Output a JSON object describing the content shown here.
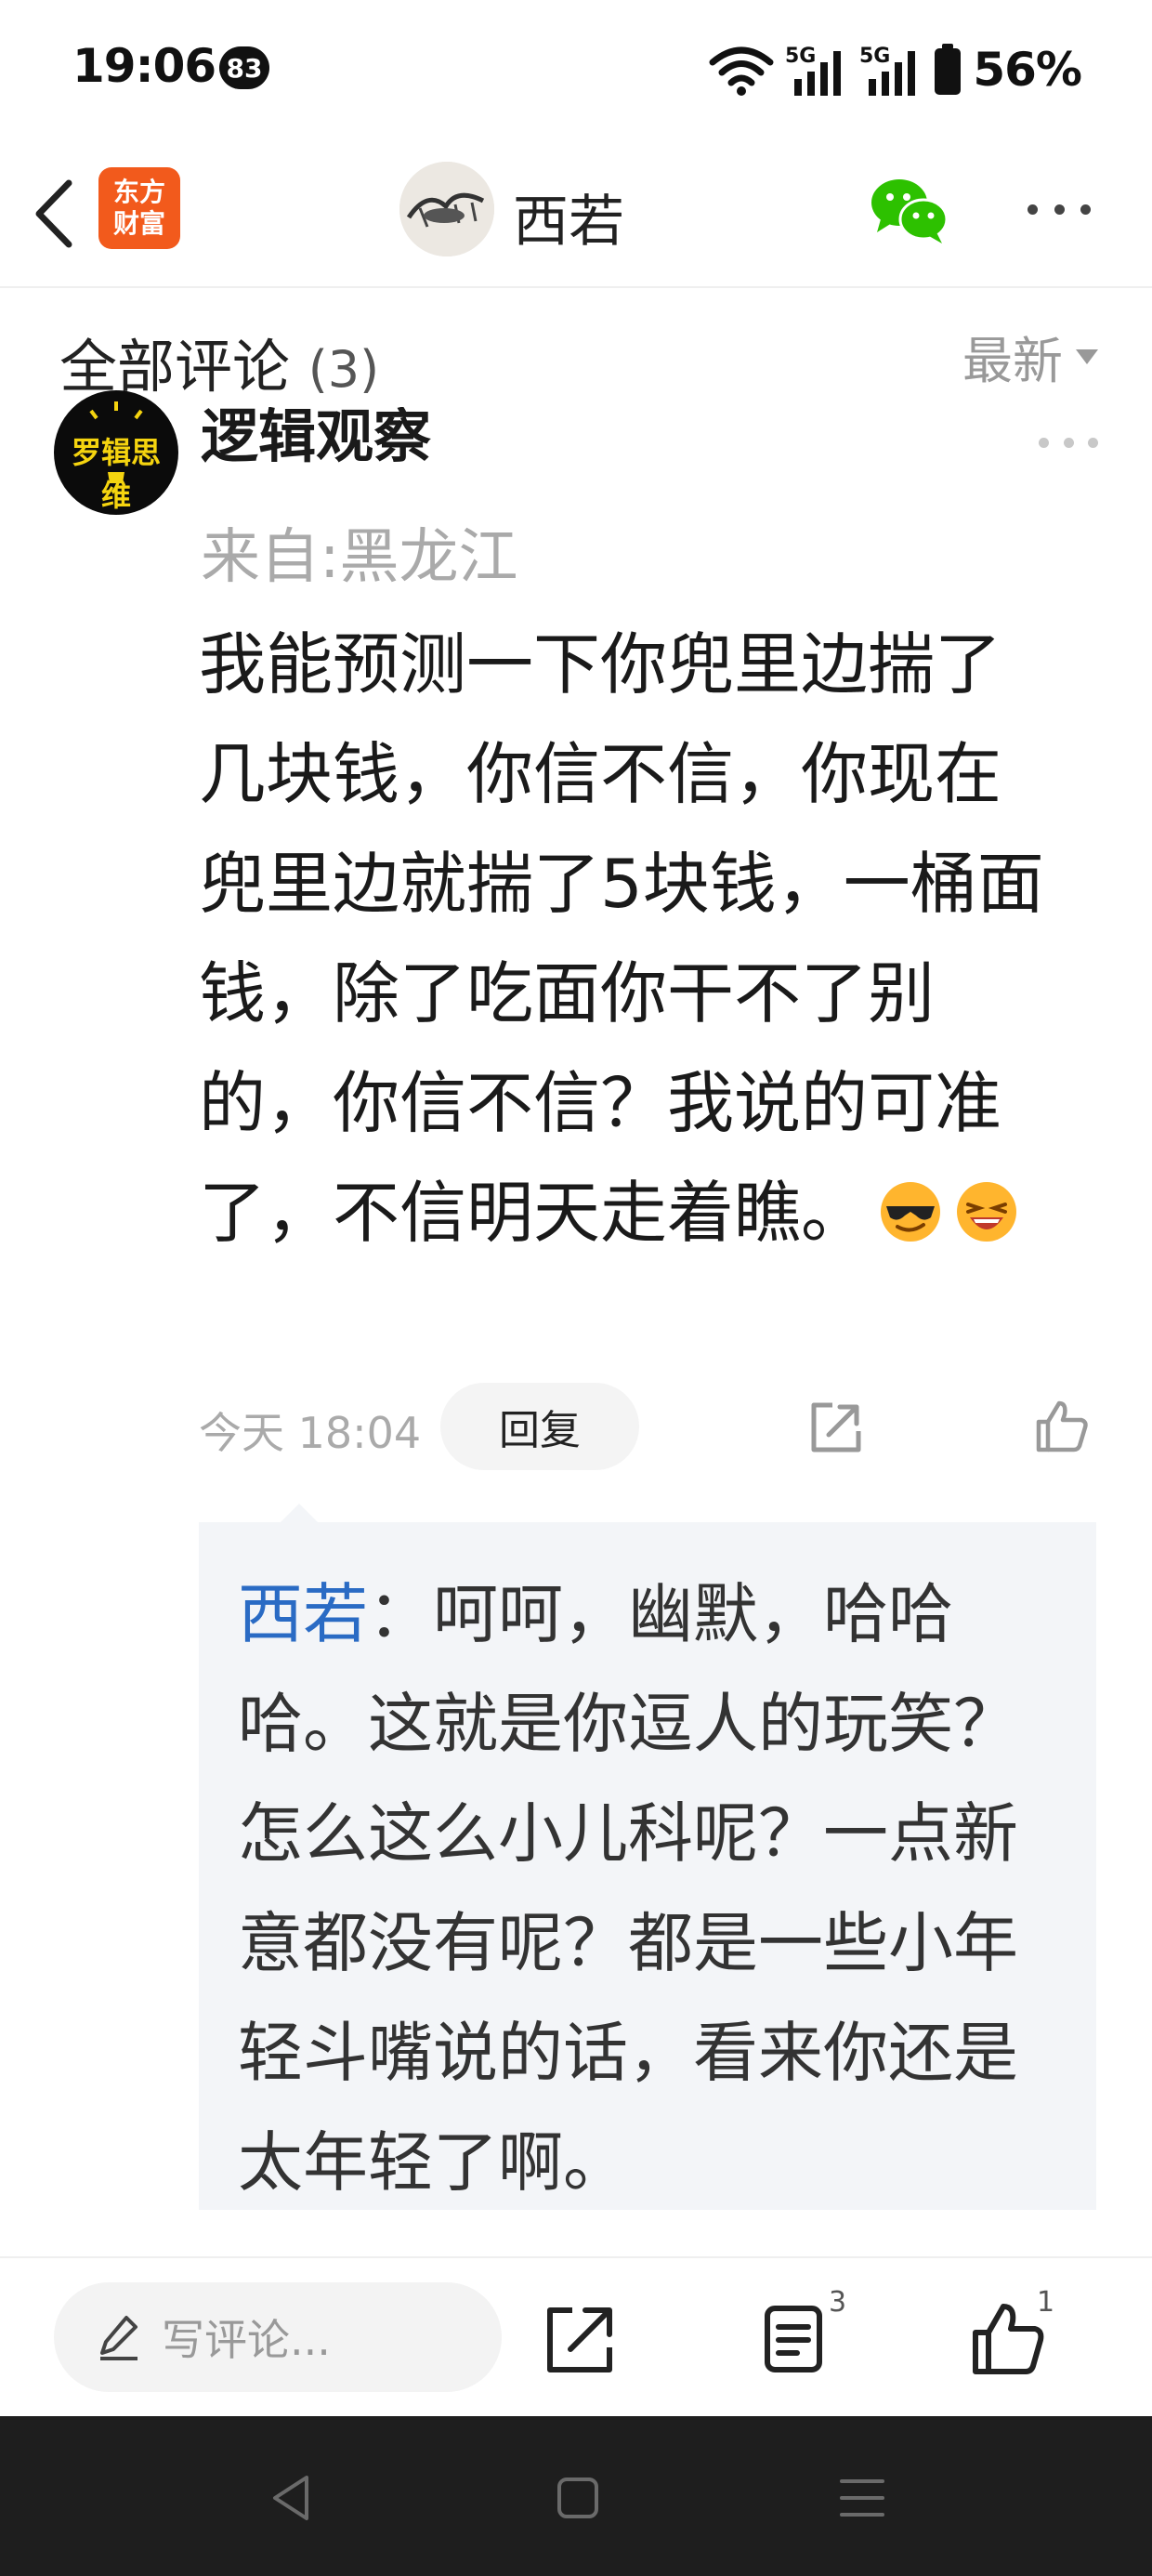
{
  "status_bar": {
    "time": "19:06",
    "notification_count": "83",
    "network_1": "5G",
    "network_2": "5G",
    "battery": "56%"
  },
  "header": {
    "app_logo_line1": "东方",
    "app_logo_line2": "财富",
    "author_name": "西若",
    "icons": [
      "back-arrow-icon",
      "wechat-icon",
      "more-icon"
    ]
  },
  "comments": {
    "title": "全部评论",
    "count": "(3)",
    "sort_label": "最新"
  },
  "comment": {
    "avatar_text": "罗辑思维",
    "author": "逻辑观察",
    "location": "来自:黑龙江",
    "body": "我能预测一下你兜里边揣了几块钱，你信不信，你现在兜里边就揣了5块钱，一桶面钱，除了吃面你干不了别的，你信不信？我说的可准了，不信明天走着瞧。",
    "emojis": [
      "sunglasses-emoji",
      "laughing-emoji"
    ],
    "time": "今天 18:04",
    "reply_label": "回复"
  },
  "reply": {
    "author": "西若",
    "separator": "：",
    "text": "呵呵，幽默，哈哈哈。这就是你逗人的玩笑？怎么这么小儿科呢？一点新意都没有呢？都是一些小年轻斗嘴说的话，看来你还是太年轻了啊。"
  },
  "bottom_bar": {
    "input_placeholder": "写评论...",
    "comment_count": "3",
    "like_count": "1"
  },
  "colors": {
    "accent_orange": "#f25a1c",
    "reply_author_blue": "#2a6bc4",
    "wechat_green": "#2dc100"
  }
}
